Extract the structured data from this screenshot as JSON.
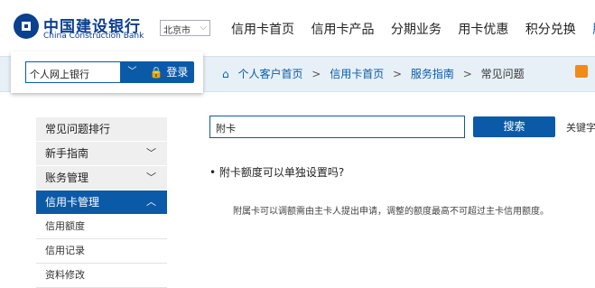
{
  "header": {
    "brand_cn": "中国建设银行",
    "brand_en": "China Construction Bank",
    "city": "北京市",
    "nav": [
      "信用卡首页",
      "信用卡产品",
      "分期业务",
      "用卡优惠",
      "积分兑换",
      "服务"
    ]
  },
  "login": {
    "channel": "个人网上银行",
    "button": "登录"
  },
  "breadcrumb": {
    "items": [
      "个人客户首页",
      "信用卡首页",
      "服务指南",
      "常见问题"
    ],
    "separator": ">"
  },
  "sidebar": {
    "items": [
      {
        "label": "常见问题排行"
      },
      {
        "label": "新手指南"
      },
      {
        "label": "账务管理"
      },
      {
        "label": "信用卡管理"
      }
    ],
    "subitems": [
      "信用额度",
      "信用记录",
      "资料修改"
    ]
  },
  "search": {
    "value": "附卡",
    "button": "搜索",
    "keyword_label": "关键字"
  },
  "faq": {
    "question": "附卡额度可以单独设置吗?",
    "answer": "附属卡可以调额需由主卡人提出申请，调整的额度最高不可超过主卡信用额度。"
  },
  "colors": {
    "primary": "#0b5aa8",
    "bar": "#e7f0f7",
    "accent": "#f08a1c"
  }
}
